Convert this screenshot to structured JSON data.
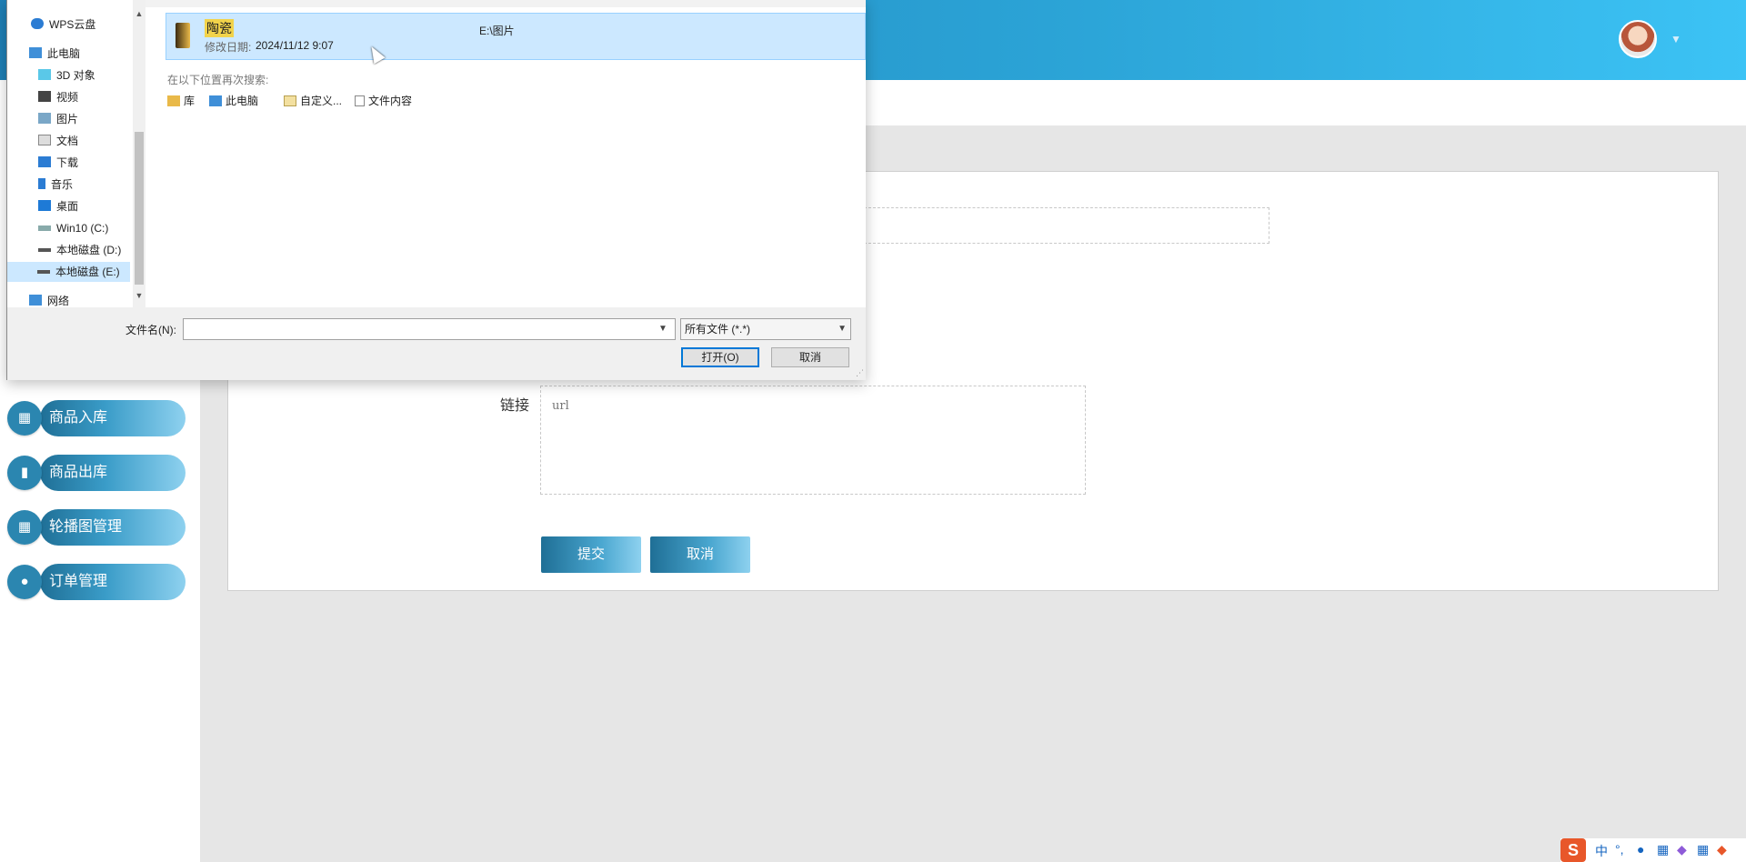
{
  "header": {
    "avatar_name": "user-avatar",
    "caret": "▼"
  },
  "sidebar": {
    "items": [
      {
        "label": "商品入库",
        "icon": "grid-icon",
        "glyph": "▦"
      },
      {
        "label": "商品出库",
        "icon": "bar-chart-icon",
        "glyph": "▮"
      },
      {
        "label": "轮播图管理",
        "icon": "grid-icon",
        "glyph": "▦"
      },
      {
        "label": "订单管理",
        "icon": "bulb-icon",
        "glyph": "●"
      }
    ]
  },
  "form": {
    "link_label": "链接",
    "link_placeholder": "url",
    "submit_label": "提交",
    "cancel_label": "取消"
  },
  "dialog": {
    "nav": [
      {
        "label": "WPS云盘",
        "icon": "cloud-icon"
      },
      {
        "label": "此电脑",
        "icon": "computer-icon"
      },
      {
        "label": "3D 对象",
        "icon": "cube-icon"
      },
      {
        "label": "视频",
        "icon": "video-icon"
      },
      {
        "label": "图片",
        "icon": "picture-icon"
      },
      {
        "label": "文档",
        "icon": "document-icon"
      },
      {
        "label": "下载",
        "icon": "download-icon"
      },
      {
        "label": "音乐",
        "icon": "music-icon"
      },
      {
        "label": "桌面",
        "icon": "desktop-icon"
      },
      {
        "label": "Win10 (C:)",
        "icon": "drive-icon"
      },
      {
        "label": "本地磁盘 (D:)",
        "icon": "drive-icon"
      },
      {
        "label": "本地磁盘 (E:)",
        "icon": "drive-icon",
        "selected": true
      },
      {
        "label": "网络",
        "icon": "network-icon"
      }
    ],
    "result": {
      "name": "陶瓷",
      "date_label": "修改日期:",
      "date": "2024/11/12 9:07",
      "path": "E:\\图片"
    },
    "search_again_label": "在以下位置再次搜索:",
    "search_locations": [
      "库",
      "此电脑",
      "自定义...",
      "文件内容"
    ],
    "filename_label": "文件名(N):",
    "filename_value": "",
    "filter": "所有文件 (*.*)",
    "open_label": "打开(O)",
    "cancel_label": "取消"
  },
  "tray": {
    "ime": "S",
    "mode": "中",
    "punct": "°,"
  }
}
